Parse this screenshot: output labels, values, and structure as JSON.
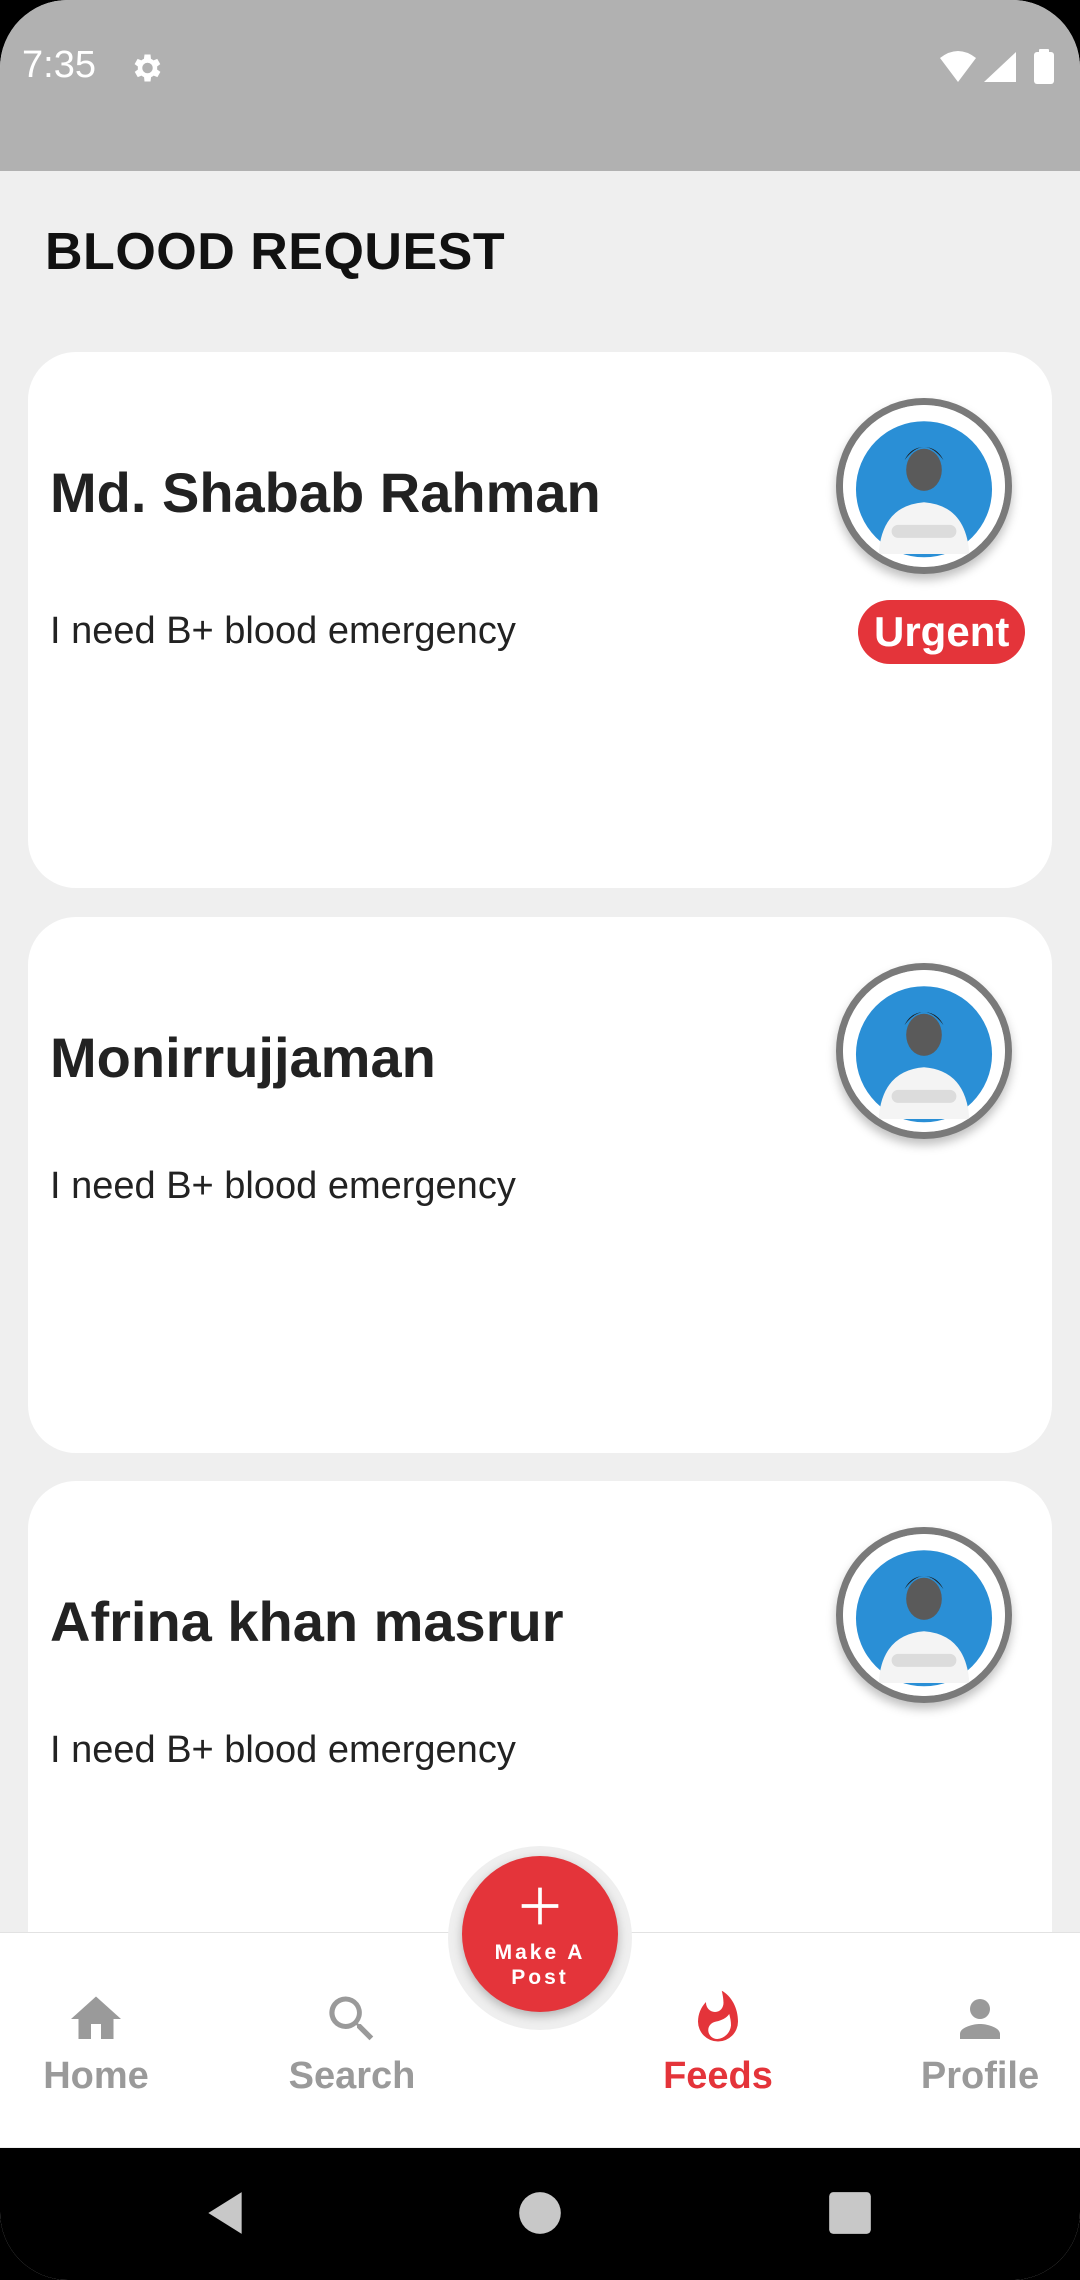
{
  "status_bar": {
    "time": "7:35",
    "icons": [
      "gear-icon",
      "wifi-icon",
      "signal-icon",
      "battery-icon"
    ],
    "background": "#b1b1b1"
  },
  "header": {
    "title": "BLOOD REQUEST"
  },
  "requests": [
    {
      "name": "Md. Shabab Rahman",
      "message": "I need B+ blood emergency",
      "badge": "Urgent"
    },
    {
      "name": "Monirrujjaman",
      "message": "I need B+ blood emergency",
      "badge": ""
    },
    {
      "name": "Afrina khan masrur",
      "message": "I need B+ blood emergency",
      "badge": ""
    }
  ],
  "fab": {
    "label": "Make A Post",
    "icon": "plus-icon"
  },
  "bottom_nav": {
    "items": [
      {
        "label": "Home",
        "icon": "home-icon",
        "active": false
      },
      {
        "label": "Search",
        "icon": "search-icon",
        "active": false
      },
      {
        "label": "Feeds",
        "icon": "flame-icon",
        "active": true
      },
      {
        "label": "Profile",
        "icon": "person-icon",
        "active": false
      }
    ]
  },
  "colors": {
    "accent": "#e4343a",
    "inactive": "#9a9a9a",
    "background": "#efefef",
    "card": "#ffffff"
  },
  "system_nav": [
    "back-icon",
    "home-circle-icon",
    "recents-icon"
  ]
}
